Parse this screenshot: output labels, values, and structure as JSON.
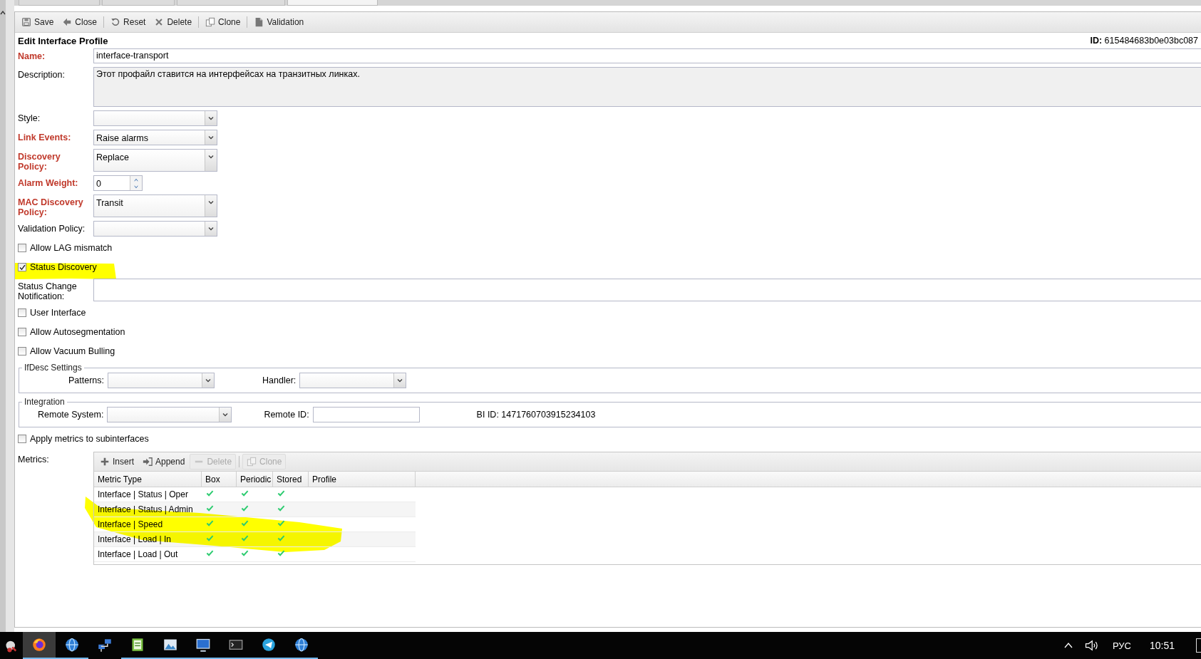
{
  "tabs": [
    {
      "selected": false
    },
    {
      "selected": false
    },
    {
      "selected": false
    },
    {
      "selected": true
    }
  ],
  "toolbar": [
    {
      "kind": "save",
      "label": "Save"
    },
    {
      "kind": "close",
      "label": "Close"
    },
    {
      "kind": "separator"
    },
    {
      "kind": "reset",
      "label": "Reset"
    },
    {
      "kind": "delete",
      "label": "Delete"
    },
    {
      "kind": "separator"
    },
    {
      "kind": "clone",
      "label": "Clone"
    },
    {
      "kind": "separator"
    },
    {
      "kind": "validation",
      "label": "Validation"
    }
  ],
  "form": {
    "title": "Edit Interface Profile",
    "id_label": "ID:",
    "id_value": "615484683b0e03bc087"
  },
  "items": [
    {
      "kind": "text",
      "label": "Name:",
      "required": true,
      "value": "interface-transport"
    },
    {
      "kind": "textarea",
      "label": "Description:",
      "required": false,
      "value": "Этот профайл ставится на интерфейсах на транзитных линках."
    },
    {
      "kind": "combo",
      "label": "Style:",
      "required": false
    },
    {
      "kind": "combo",
      "label": "Link Events:",
      "required": true,
      "value": "Raise alarms"
    },
    {
      "kind": "combo",
      "label": "Discovery Policy:",
      "required": true,
      "value": "Replace"
    },
    {
      "kind": "spinner",
      "label": "Alarm Weight:",
      "required": true,
      "value": "0"
    },
    {
      "kind": "combo",
      "label": "MAC Discovery Policy:",
      "required": true,
      "value": "Transit"
    },
    {
      "kind": "combo",
      "label": "Validation Policy:",
      "required": false
    },
    {
      "kind": "checkbox",
      "label": "Allow LAG mismatch",
      "checked": false
    },
    {
      "kind": "checkbox",
      "label": "Status Discovery",
      "checked": true
    },
    {
      "kind": "text",
      "label": "Status Change Notification:",
      "required": false
    },
    {
      "kind": "checkbox",
      "label": "User Interface",
      "checked": false
    },
    {
      "kind": "checkbox",
      "label": "Allow Autosegmentation",
      "checked": false
    },
    {
      "kind": "checkbox",
      "label": "Allow Vacuum Bulling",
      "checked": false
    }
  ],
  "ifdesc": {
    "legend": "IfDesc Settings",
    "fields": [
      {
        "kind": "combo",
        "label": "Patterns:"
      },
      {
        "kind": "combo",
        "label": "Handler:"
      }
    ]
  },
  "integration": {
    "legend": "Integration",
    "fields": [
      {
        "kind": "combo",
        "label": "Remote System:"
      },
      {
        "kind": "text",
        "label": "Remote ID:"
      },
      {
        "kind": "info",
        "label": "BI ID: 1471760703915234103"
      }
    ]
  },
  "apply_metrics": {
    "label": "Apply metrics to subinterfaces",
    "checked": false
  },
  "metrics": {
    "label": "Metrics:",
    "toolbar": [
      {
        "kind": "insert",
        "label": "Insert",
        "disabled": false
      },
      {
        "kind": "append",
        "label": "Append",
        "disabled": false
      },
      {
        "kind": "remove",
        "label": "Delete",
        "disabled": true
      },
      {
        "kind": "separator"
      },
      {
        "kind": "clone",
        "label": "Clone",
        "disabled": true
      }
    ],
    "columns": [
      "Metric Type",
      "Box",
      "Periodic",
      "Stored",
      "Profile"
    ],
    "rows": [
      {
        "metric_type": "Interface | Status | Oper",
        "box": true,
        "periodic": true,
        "stored": true
      },
      {
        "metric_type": "Interface | Status | Admin",
        "box": true,
        "periodic": true,
        "stored": true
      },
      {
        "metric_type": "Interface | Speed",
        "box": true,
        "periodic": true,
        "stored": true
      },
      {
        "metric_type": "Interface | Load | In",
        "box": true,
        "periodic": true,
        "stored": true
      },
      {
        "metric_type": "Interface | Load | Out",
        "box": true,
        "periodic": true,
        "stored": true
      }
    ]
  },
  "taskbar": {
    "apps": [
      {
        "kind": "firefox",
        "active": true,
        "running": true
      },
      {
        "kind": "globe",
        "active": false,
        "running": true
      },
      {
        "kind": "network",
        "active": false,
        "running": false
      },
      {
        "kind": "notepad",
        "active": false,
        "running": true
      },
      {
        "kind": "image",
        "active": false,
        "running": true
      },
      {
        "kind": "monitor",
        "active": false,
        "running": true
      },
      {
        "kind": "terminal",
        "active": false,
        "running": true
      },
      {
        "kind": "telegram",
        "active": false,
        "running": true
      },
      {
        "kind": "globe",
        "active": false,
        "running": true
      }
    ],
    "language": "РУС",
    "time": "10:51"
  }
}
